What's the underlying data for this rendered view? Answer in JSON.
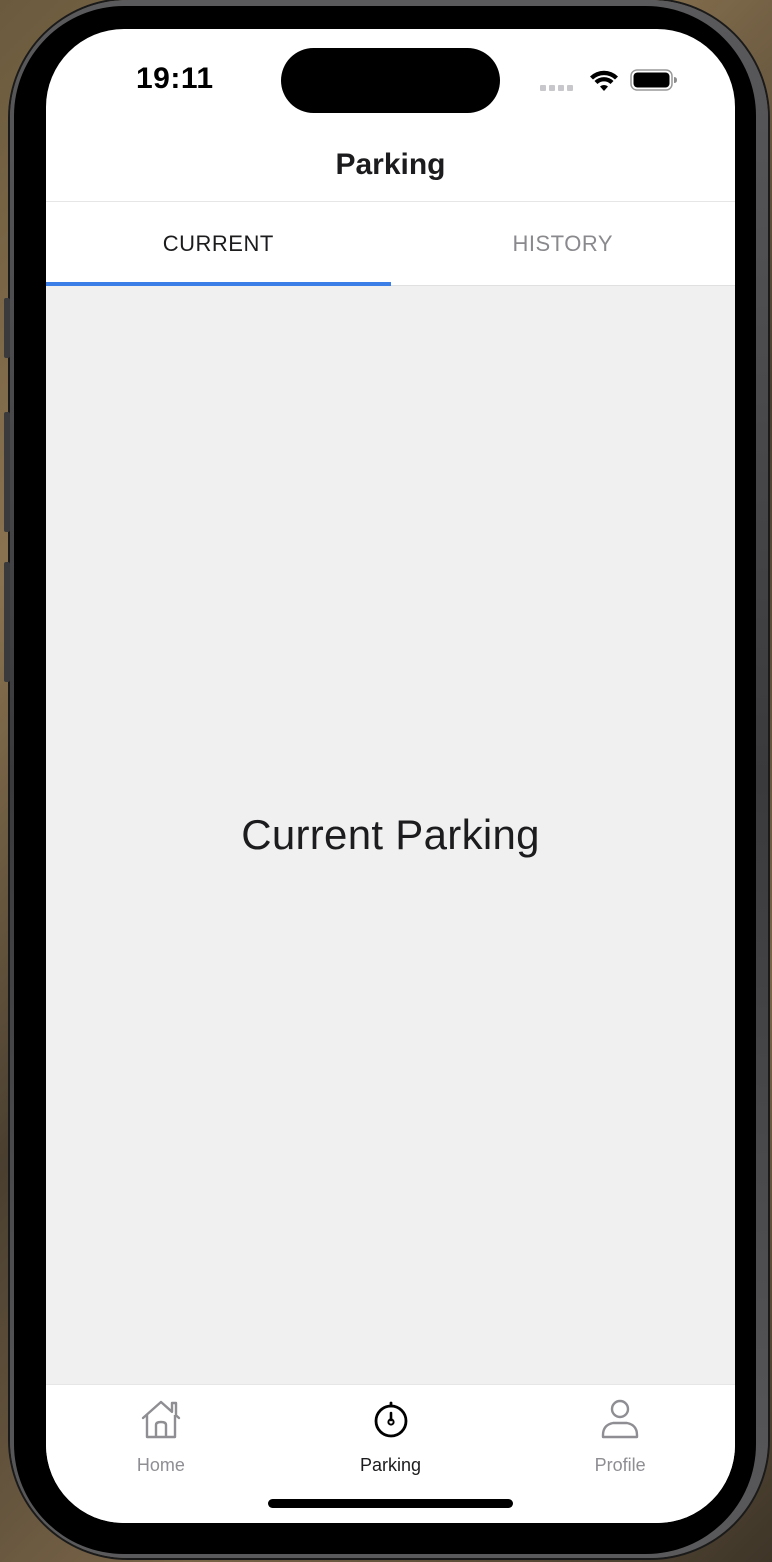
{
  "status_bar": {
    "time": "19:11"
  },
  "header": {
    "title": "Parking"
  },
  "top_tabs": [
    {
      "label": "CURRENT",
      "active": true
    },
    {
      "label": "HISTORY",
      "active": false
    }
  ],
  "main": {
    "text": "Current Parking"
  },
  "bottom_tabs": [
    {
      "label": "Home",
      "icon": "home-icon",
      "active": false
    },
    {
      "label": "Parking",
      "icon": "stopwatch-icon",
      "active": true
    },
    {
      "label": "Profile",
      "icon": "person-icon",
      "active": false
    }
  ],
  "colors": {
    "accent": "#3b7ee8",
    "content_bg": "#f0f0f0",
    "inactive": "#8e8e93"
  }
}
